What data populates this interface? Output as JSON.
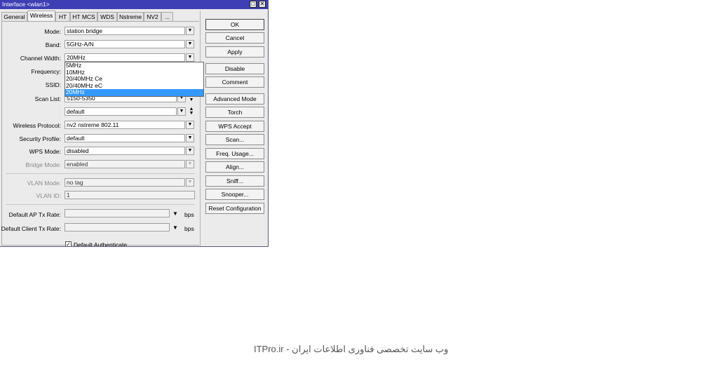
{
  "window": {
    "title": "Interface <wlan1>",
    "minimize_label": "□",
    "close_label": "✕"
  },
  "tabs": [
    {
      "label": "General"
    },
    {
      "label": "Wireless"
    },
    {
      "label": "HT"
    },
    {
      "label": "HT MCS"
    },
    {
      "label": "WDS"
    },
    {
      "label": "Nstreme"
    },
    {
      "label": "NV2"
    },
    {
      "label": "..."
    }
  ],
  "active_tab": "Wireless",
  "form": {
    "mode": {
      "label": "Mode:",
      "value": "station bridge"
    },
    "band": {
      "label": "Band:",
      "value": "5GHz-A/N"
    },
    "channel_width": {
      "label": "Channel Width:",
      "value": "20MHz"
    },
    "frequency": {
      "label": "Frequency:"
    },
    "ssid": {
      "label": "SSID:"
    },
    "scan_list": {
      "label": "Scan List:",
      "value": "5150-5350"
    },
    "extra": {
      "value": "default"
    },
    "wireless_protocol": {
      "label": "Wireless Protocol:",
      "value": "nv2 nstreme 802.11"
    },
    "security_profile": {
      "label": "Security Profile:",
      "value": "default"
    },
    "wps_mode": {
      "label": "WPS Mode:",
      "value": "disabled"
    },
    "bridge_mode": {
      "label": "Bridge Mode:",
      "value": "enabled"
    },
    "vlan_mode": {
      "label": "VLAN Mode:",
      "value": "no tag"
    },
    "vlan_id": {
      "label": "VLAN ID:",
      "value": "1"
    },
    "default_ap_tx_rate": {
      "label": "Default AP Tx Rate:",
      "value": "",
      "unit": "bps"
    },
    "default_client_tx_rate": {
      "label": "Default Client Tx Rate:",
      "value": "",
      "unit": "bps"
    },
    "default_authenticate": {
      "label": "Default Authenticate",
      "checked": true
    }
  },
  "channel_width_options": [
    "5MHz",
    "10MHz",
    "20/40MHz Ce",
    "20/40MHz eC",
    "20MHz"
  ],
  "channel_width_selected": "20MHz",
  "buttons": {
    "ok": "OK",
    "cancel": "Cancel",
    "apply": "Apply",
    "disable": "Disable",
    "comment": "Comment",
    "advanced_mode": "Advanced Mode",
    "torch": "Torch",
    "wps_accept": "WPS Accept",
    "scan": "Scan...",
    "freq_usage": "Freq. Usage...",
    "align": "Align...",
    "sniff": "Sniff...",
    "snooper": "Snooper...",
    "reset_configuration": "Reset Configuration"
  },
  "caption": "ITPro.ir - وب سایت تخصصی فناوری اطلاعات ایران",
  "colors": {
    "titlebar": "#3f3fb5",
    "selection": "#3399ff",
    "window_bg": "#ebebeb"
  }
}
